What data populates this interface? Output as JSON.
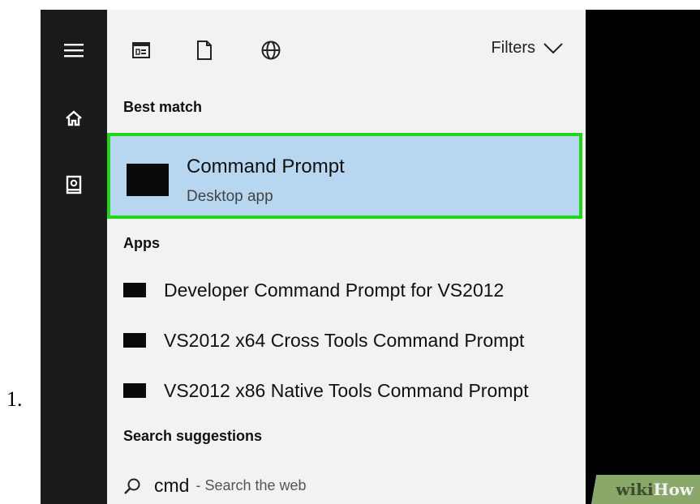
{
  "step": {
    "number": "1."
  },
  "sidebar": {
    "items": [
      {
        "name": "menu",
        "icon": "hamburger-menu-icon"
      },
      {
        "name": "home",
        "icon": "home-icon"
      },
      {
        "name": "documents",
        "icon": "photo-book-icon"
      }
    ]
  },
  "toolbar": {
    "icons": [
      "apps-window-icon",
      "document-icon",
      "globe-icon"
    ],
    "filters_label": "Filters"
  },
  "best_match": {
    "section_title": "Best match",
    "title": "Command Prompt",
    "subtitle": "Desktop app"
  },
  "apps": {
    "section_title": "Apps",
    "items": [
      "Developer Command Prompt for VS2012",
      "VS2012 x64 Cross Tools Command Prompt",
      "VS2012 x86 Native Tools Command Prompt"
    ]
  },
  "search_suggestions": {
    "section_title": "Search suggestions",
    "query": "cmd",
    "hint": "- Search the web"
  },
  "watermark": {
    "wiki": "wiki",
    "how": "How"
  },
  "colors": {
    "highlight_border": "#22d61a",
    "selected_bg": "#b6d7ef",
    "rail_bg": "#1a1a1a",
    "panel_bg": "#f2f2f2"
  }
}
